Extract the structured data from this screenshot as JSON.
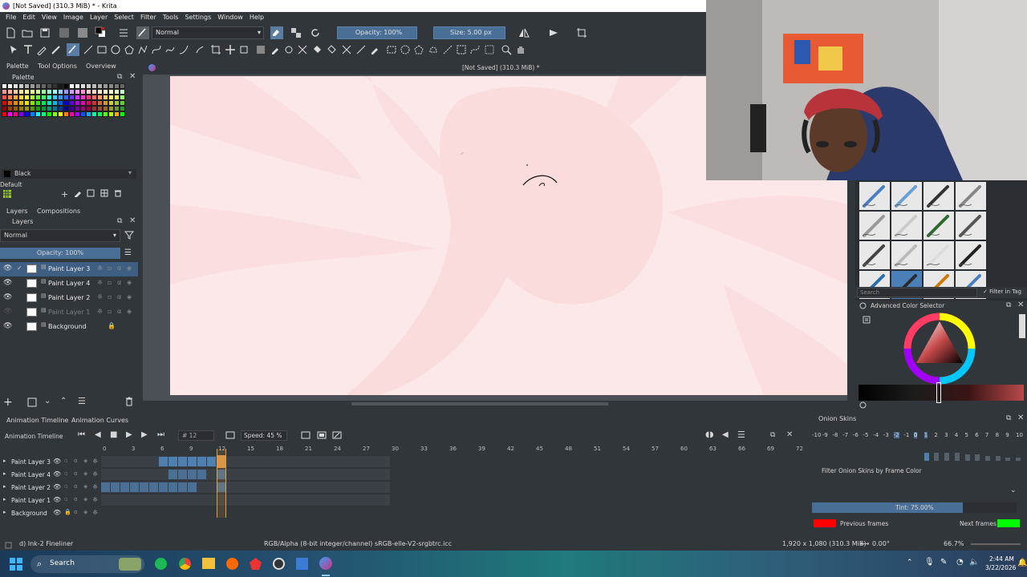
{
  "window": {
    "title": "[Not Saved]  (310.3 MiB) * - Krita"
  },
  "menu": [
    "File",
    "Edit",
    "View",
    "Image",
    "Layer",
    "Select",
    "Filter",
    "Tools",
    "Settings",
    "Window",
    "Help"
  ],
  "toolbar": {
    "blend_mode": "Normal",
    "opacity": "Opacity: 100%",
    "size": "Size: 5.00 px"
  },
  "docker_tabs": [
    "Palette",
    "Tool Options",
    "Overview"
  ],
  "palette": {
    "title": "Palette",
    "current_color_name": "Black",
    "palette_name": "Default",
    "colors": [
      "#ffffff",
      "#f2f2f2",
      "#e0e0e0",
      "#cccccc",
      "#b3b3b3",
      "#999999",
      "#808080",
      "#666666",
      "#4d4d4d",
      "#333333",
      "#1a1a1a",
      "#000000",
      "#ffffff",
      "#eeeeee",
      "#dddddd",
      "#cccccc",
      "#bbbbbb",
      "#aaaaaa",
      "#999999",
      "#888888",
      "#777777",
      "#666666",
      "#ff9999",
      "#ffb399",
      "#ffcc99",
      "#ffe699",
      "#ffff99",
      "#e6ff99",
      "#ccff99",
      "#99ff99",
      "#99ffcc",
      "#99ffff",
      "#99ccff",
      "#9999ff",
      "#cc99ff",
      "#ff99ff",
      "#ff99cc",
      "#ffcccc",
      "#ffd9cc",
      "#ffe6cc",
      "#fff2cc",
      "#ffffcc",
      "#e6ffcc",
      "#ccffcc",
      "#ff4d4d",
      "#ff8040",
      "#ffaa33",
      "#ffd633",
      "#ffff33",
      "#b3ff33",
      "#66ff33",
      "#33ff66",
      "#33ffcc",
      "#33ccff",
      "#3399ff",
      "#3366ff",
      "#6633ff",
      "#cc33ff",
      "#ff33cc",
      "#ff3380",
      "#ff6666",
      "#ff9966",
      "#ffcc66",
      "#ffee66",
      "#eeff66",
      "#99ff66",
      "#e60000",
      "#e65c00",
      "#e68a00",
      "#e6b800",
      "#e6e600",
      "#8ae600",
      "#2ee600",
      "#00e65c",
      "#00e6b8",
      "#00b8e6",
      "#005ce6",
      "#0000e6",
      "#5c00e6",
      "#b800e6",
      "#e600b8",
      "#e6005c",
      "#cc3333",
      "#cc6633",
      "#cc9933",
      "#cccc33",
      "#99cc33",
      "#66cc33",
      "#990000",
      "#993d00",
      "#995c00",
      "#997a00",
      "#999900",
      "#5c9900",
      "#1f9900",
      "#00993d",
      "#00997a",
      "#007a99",
      "#003d99",
      "#000099",
      "#3d0099",
      "#7a0099",
      "#99007a",
      "#99003d",
      "#993333",
      "#994d33",
      "#996633",
      "#999933",
      "#669933",
      "#339933",
      "#ff0000",
      "#ff00ff",
      "#ff0080",
      "#8000ff",
      "#0000ff",
      "#0080ff",
      "#00ffff",
      "#00ff80",
      "#00ff00",
      "#80ff00",
      "#ffff00",
      "#ff8000",
      "#ff00aa",
      "#aa00ff",
      "#0055ff",
      "#00aaff",
      "#00ffaa",
      "#00ff55",
      "#55ff00",
      "#aaff00",
      "#ffaa00",
      "#00ff00"
    ]
  },
  "layers_docker": {
    "tabs": [
      "Layers",
      "Compositions"
    ],
    "blend_mode": "Normal",
    "opacity": "Opacity:  100%",
    "layers": [
      {
        "name": "Paint Layer 3",
        "active": true,
        "visible": true
      },
      {
        "name": "Paint Layer 4",
        "active": false,
        "visible": true
      },
      {
        "name": "Paint Layer 2",
        "active": false,
        "visible": true
      },
      {
        "name": "Paint Layer 1",
        "active": false,
        "visible": false
      },
      {
        "name": "Background",
        "active": false,
        "visible": true,
        "locked": true
      }
    ]
  },
  "canvas": {
    "header": "[Not Saved]  (310.3 MiB) *",
    "background_color": "#fde8e9"
  },
  "timeline": {
    "tabs": [
      "Animation Timeline",
      "Animation Curves"
    ],
    "title": "Animation Timeline",
    "current_frame": "12",
    "speed": "Speed: 45 %",
    "frame_ticks": [
      "0",
      "3",
      "6",
      "9",
      "12",
      "15",
      "18",
      "21",
      "24",
      "27",
      "30",
      "33",
      "36",
      "39",
      "42",
      "45",
      "48",
      "51",
      "54",
      "57",
      "60",
      "63",
      "66",
      "69",
      "72"
    ],
    "layers": [
      "Paint Layer 3",
      "Paint Layer 4",
      "Paint Layer 2",
      "Paint Layer 1",
      "Background"
    ]
  },
  "onion_skins": {
    "title": "Onion Skins",
    "numbers": [
      "-10",
      "-9",
      "-8",
      "-7",
      "-6",
      "-5",
      "-4",
      "-3",
      "-2",
      "-1",
      "0",
      "1",
      "2",
      "3",
      "4",
      "5",
      "6",
      "7",
      "8",
      "9",
      "10"
    ],
    "filter_label": "Filter Onion Skins by Frame Color",
    "tint": "Tint: 75.00%",
    "previous_label": "Previous frames",
    "next_label": "Next frames",
    "previous_color": "#ff0000",
    "next_color": "#00ff00"
  },
  "brush_presets": {
    "search_placeholder": "Search",
    "filter_label": "Filter in Tag"
  },
  "color_selector": {
    "title": "Advanced Color Selector"
  },
  "status": {
    "brush": "d) Ink-2 Fineliner",
    "color_space": "RGB/Alpha (8-bit integer/channel)  sRGB-elle-V2-srgbtrc.icc",
    "dimensions": "1,920 x 1,080 (310.3 MiB)",
    "rotation": "0.00°",
    "zoom": "66.7%"
  },
  "taskbar": {
    "search_label": "Search",
    "time": "2:44 AM",
    "date": "3/22/2026"
  }
}
